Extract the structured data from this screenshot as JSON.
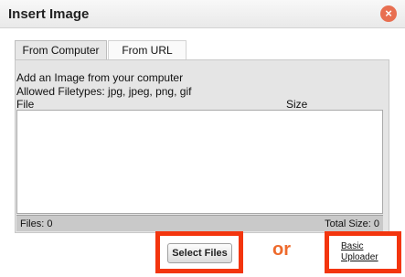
{
  "dialog": {
    "title": "Insert Image",
    "close_icon": "×"
  },
  "tabs": [
    {
      "label": "From Computer",
      "active": true
    },
    {
      "label": "From URL",
      "active": false
    }
  ],
  "instructions": {
    "line1": "Add an Image from your computer",
    "line2": "Allowed Filetypes: jpg, jpeg, png, gif"
  },
  "file_table": {
    "columns": [
      "File",
      "Size"
    ],
    "rows": []
  },
  "footer": {
    "files_count": "Files: 0",
    "total_size": "Total Size: 0"
  },
  "actions": {
    "select_files_label": "Select Files",
    "or_label": "or",
    "basic_uploader_line1": "Basic",
    "basic_uploader_line2": "Uploader"
  },
  "colors": {
    "highlight": "#f3350e",
    "or_text": "#ee6a2c",
    "close_button": "#e86f51"
  }
}
